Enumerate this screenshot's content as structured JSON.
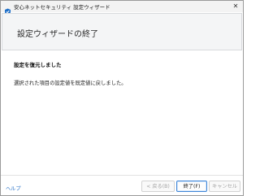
{
  "window": {
    "title": "安心ネットセキュリティ 設定ウィザード",
    "close_symbol": "✕"
  },
  "header": {
    "title": "設定ウィザードの終了"
  },
  "content": {
    "heading": "設定を復元しました",
    "message": "選択された項目の設定値を既定値に戻しました。"
  },
  "footer": {
    "help_label": "ヘルプ",
    "back_label": "< 戻る(B)",
    "finish_label": "終了(F)",
    "cancel_label": "キャンセル"
  },
  "colors": {
    "accent": "#3f86d8",
    "link": "#2a73c9",
    "icon_primary": "#1e6fc8",
    "icon_secondary": "#7bc043"
  },
  "icons": {
    "app": "security-shield-icon",
    "close": "close-icon"
  }
}
